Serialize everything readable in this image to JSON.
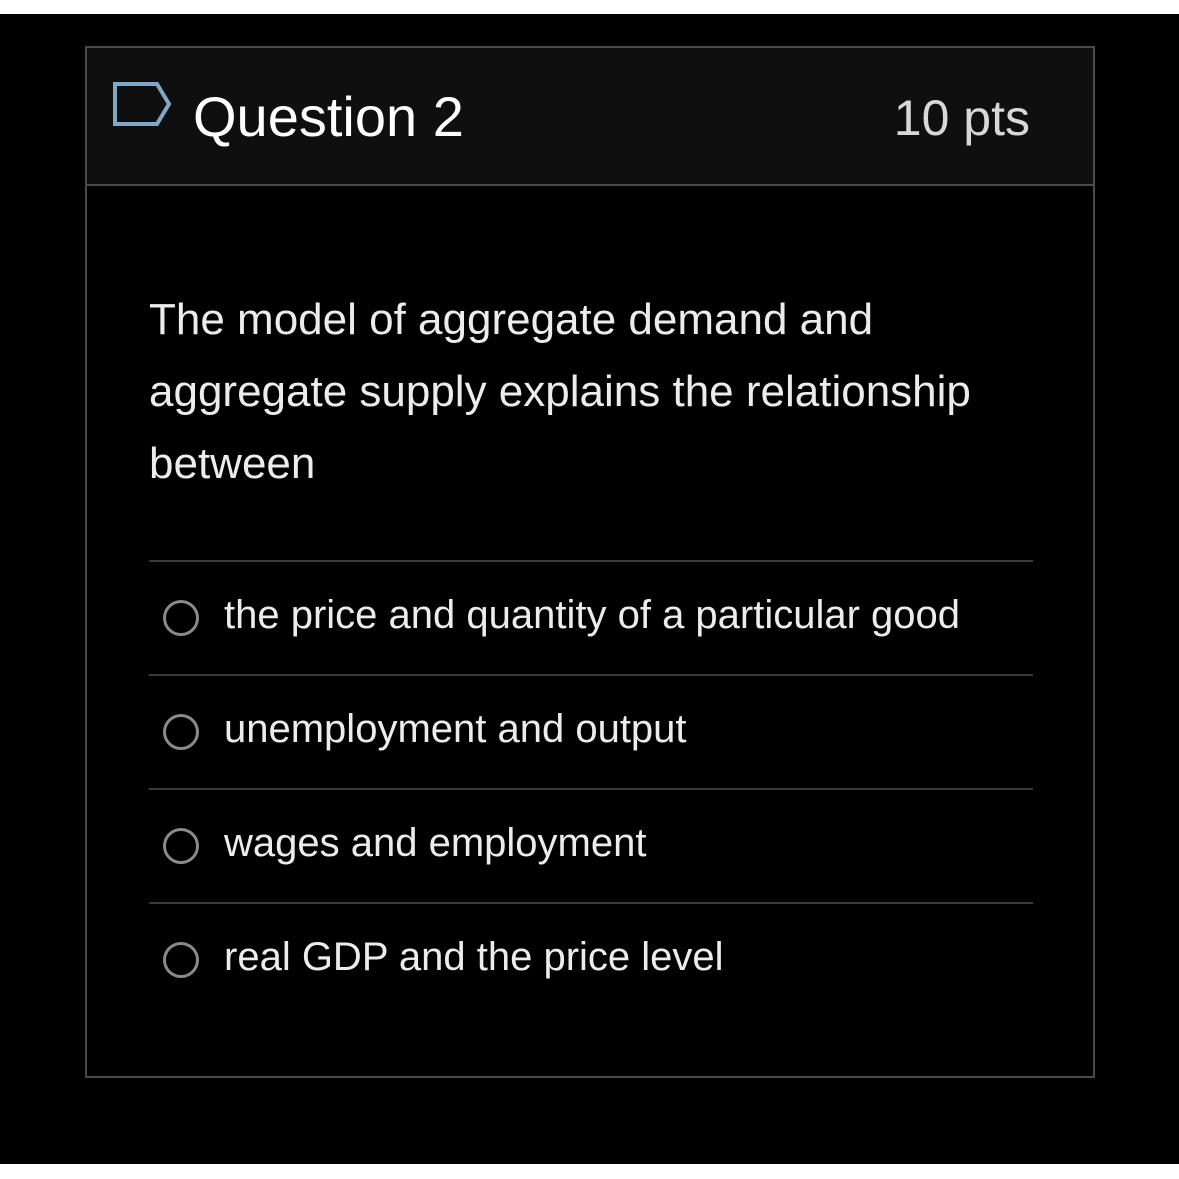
{
  "question": {
    "title": "Question 2",
    "points": "10 pts",
    "text": "The model of aggregate demand and aggregate supply explains the relationship between",
    "flag_icon": "flag-outline-icon",
    "answers": [
      {
        "label": "the price and quantity of a particular good",
        "selected": false
      },
      {
        "label": "unemployment and output",
        "selected": false
      },
      {
        "label": "wages and employment",
        "selected": false
      },
      {
        "label": "real GDP and the price level",
        "selected": false
      }
    ]
  },
  "colors": {
    "background": "#000000",
    "header_background": "#0f0f0f",
    "border": "#4a4a4a",
    "flag_stroke": "#7fa8c8",
    "text": "#ececec"
  }
}
